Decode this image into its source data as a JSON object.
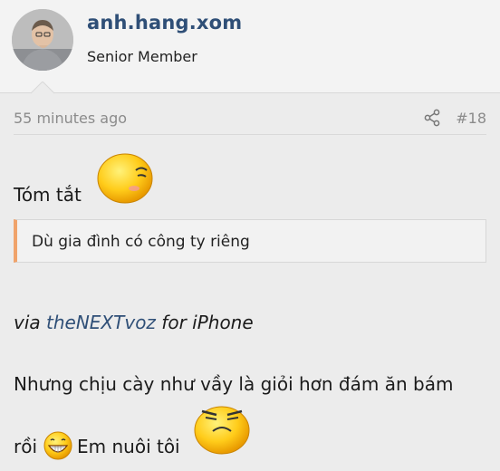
{
  "user": {
    "name": "anh.hang.xom",
    "title": "Senior Member"
  },
  "meta": {
    "time": "55 minutes ago",
    "post_number": "#18"
  },
  "post": {
    "line1": "Tóm tắt",
    "quote": "Dù gia đình có công ty riêng",
    "via_prefix": "via",
    "via_link": "theNEXTvoz",
    "via_suffix": "for iPhone",
    "line3": "Nhưng chịu cày như vầy là giỏi hơn đám ăn bám",
    "line4_a": "rồi",
    "line4_b": "Em nuôi tôi"
  },
  "icons": {
    "share": "share-icon",
    "emoji1": "wink-smiley-icon",
    "emoji2": "grin-smiley-icon",
    "emoji3": "frown-smiley-icon"
  },
  "colors": {
    "username": "#2f4f77",
    "link": "#2f4f77",
    "quote_accent": "#f0a36b",
    "muted": "#8b8b8b"
  }
}
